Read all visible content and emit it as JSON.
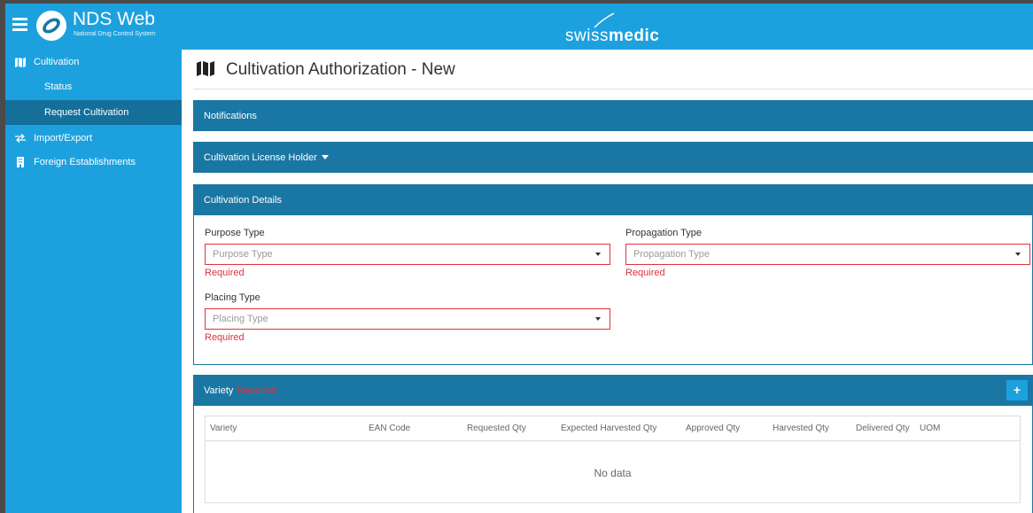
{
  "header": {
    "app_title": "NDS Web",
    "app_subtitle": "National Drug Control System",
    "brand_left": "swiss",
    "brand_right": "medic",
    "color": "#1da1de"
  },
  "sidebar": {
    "items": [
      {
        "label": "Cultivation",
        "icon": "map-icon"
      },
      {
        "label": "Status"
      },
      {
        "label": "Request Cultivation",
        "active": true
      },
      {
        "label": "Import/Export",
        "icon": "exchange-icon"
      },
      {
        "label": "Foreign Establishments",
        "icon": "building-icon"
      }
    ]
  },
  "page": {
    "title": "Cultivation Authorization - New"
  },
  "panels": {
    "notifications": "Notifications",
    "license_holder": "Cultivation License Holder",
    "details": "Cultivation Details",
    "variety": "Variety",
    "variety_required": "Required",
    "color": "#1a77a3"
  },
  "form": {
    "purpose_label": "Purpose Type",
    "purpose_placeholder": "Purpose Type",
    "propagation_label": "Propagation Type",
    "propagation_placeholder": "Propagation Type",
    "placing_label": "Placing Type",
    "placing_placeholder": "Placing Type",
    "required_text": "Required",
    "error_color": "#e2313b"
  },
  "variety_table": {
    "add_label": "+",
    "columns": [
      "Variety",
      "EAN Code",
      "Requested Qty",
      "Expected Harvested Qty",
      "Approved Qty",
      "Harvested Qty",
      "Delivered Qty",
      "UOM"
    ],
    "rows": [],
    "empty_text": "No data"
  }
}
